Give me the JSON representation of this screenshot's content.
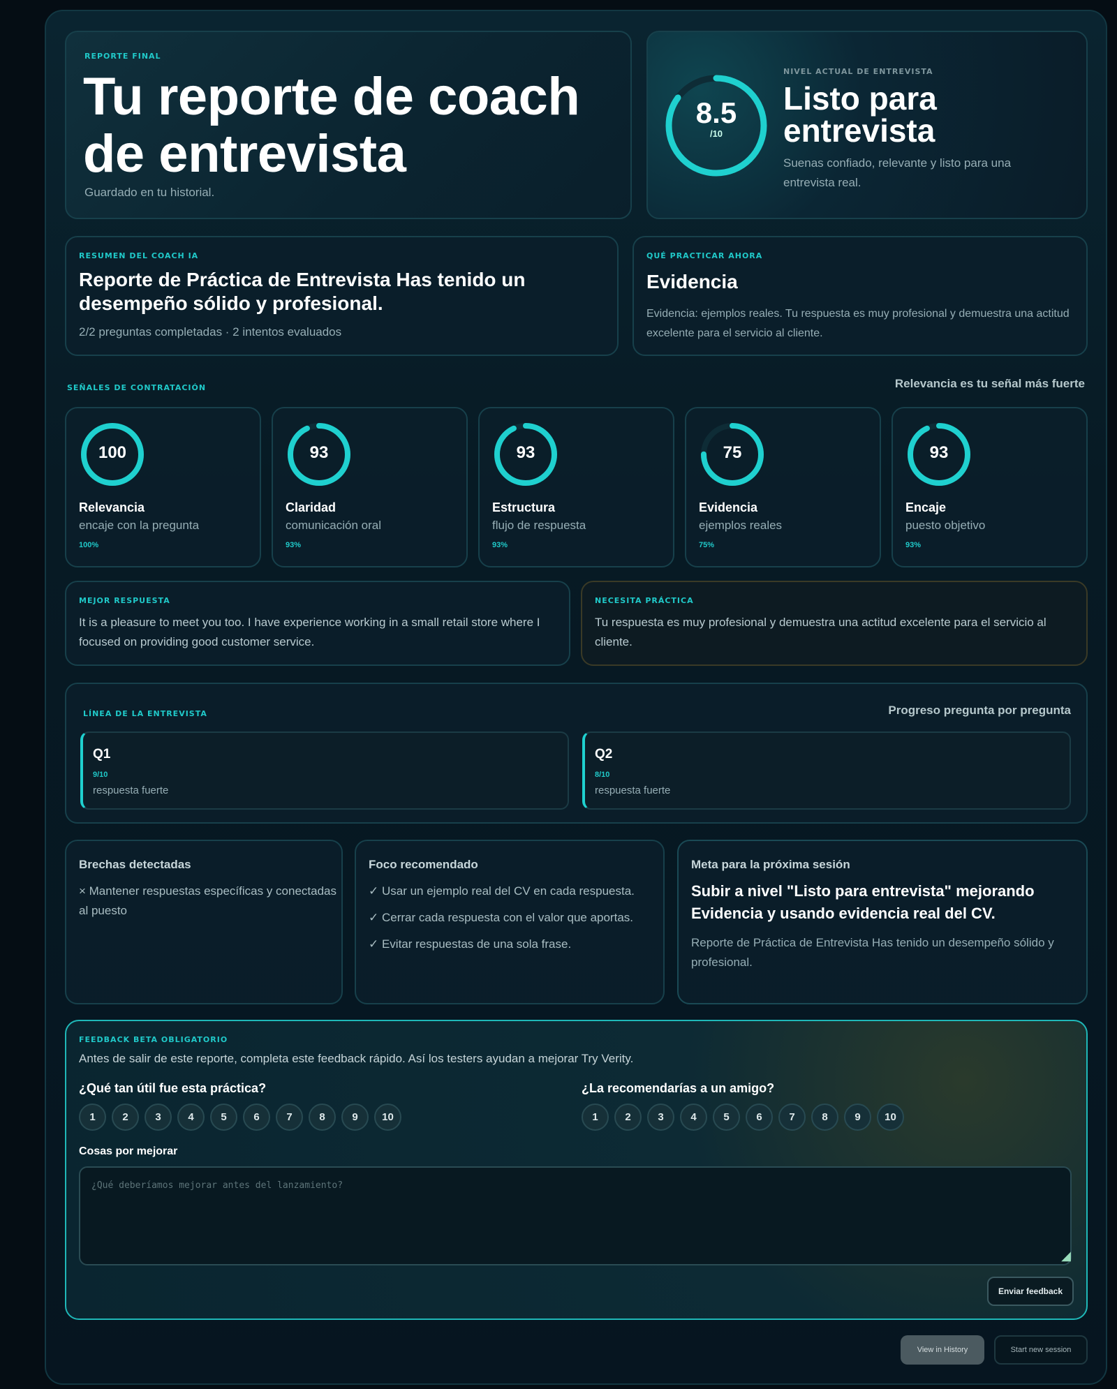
{
  "hero": {
    "eyebrow": "Reporte final",
    "title": "Tu reporte de coach de entrevista",
    "subtitle": "Guardado en tu historial."
  },
  "level": {
    "score": "8.5",
    "score_of": "/10",
    "score_fraction": 0.85,
    "eyebrow": "Nivel actual de entrevista",
    "title": "Listo para entrevista",
    "description": "Suenas confiado, relevante y listo para una entrevista real."
  },
  "summary": {
    "eyebrow": "Resumen del coach IA",
    "title": "Reporte de Práctica de Entrevista Has tenido un desempeño sólido y profesional.",
    "meta": "2/2 preguntas completadas · 2 intentos evaluados"
  },
  "practice": {
    "eyebrow": "Qué practicar ahora",
    "title": "Evidencia",
    "description": "Evidencia: ejemplos reales. Tu respuesta es muy profesional y demuestra una actitud excelente para el servicio al cliente."
  },
  "signals": {
    "label": "Señales de contratación",
    "strongest": "Relevancia es tu señal más fuerte",
    "items": [
      {
        "value": "100",
        "level": 1.0,
        "name": "Relevancia",
        "desc": "encaje con la pregunta",
        "pct": "100%"
      },
      {
        "value": "93",
        "level": 0.93,
        "name": "Claridad",
        "desc": "comunicación oral",
        "pct": "93%"
      },
      {
        "value": "93",
        "level": 0.93,
        "name": "Estructura",
        "desc": "flujo de respuesta",
        "pct": "93%"
      },
      {
        "value": "75",
        "level": 0.75,
        "name": "Evidencia",
        "desc": "ejemplos reales",
        "pct": "75%"
      },
      {
        "value": "93",
        "level": 0.93,
        "name": "Encaje",
        "desc": "puesto objetivo",
        "pct": "93%"
      }
    ]
  },
  "best": {
    "eyebrow": "Mejor respuesta",
    "text": "It is a pleasure to meet you too. I have experience working in a small retail store where I focused on providing good customer service."
  },
  "need": {
    "eyebrow": "Necesita práctica",
    "text": "Tu respuesta es muy profesional y demuestra una actitud excelente para el servicio al cliente."
  },
  "timeline": {
    "eyebrow": "Línea de la entrevista",
    "right": "Progreso pregunta por pregunta",
    "questions": [
      {
        "label": "Q1",
        "score": "9/10",
        "desc": "respuesta fuerte"
      },
      {
        "label": "Q2",
        "score": "8/10",
        "desc": "respuesta fuerte"
      }
    ]
  },
  "gaps": {
    "title": "Brechas detectadas",
    "items": [
      "× Mantener respuestas específicas y conectadas al puesto"
    ]
  },
  "focus": {
    "title": "Foco recomendado",
    "items": [
      "✓ Usar un ejemplo real del CV en cada respuesta.",
      "✓ Cerrar cada respuesta con el valor que aportas.",
      "✓ Evitar respuestas de una sola frase."
    ]
  },
  "goal": {
    "title": "Meta para la próxima sesión",
    "headline": "Subir a nivel \"Listo para entrevista\" mejorando Evidencia y usando evidencia real del CV.",
    "description": "Reporte de Práctica de Entrevista Has tenido un desempeño sólido y profesional."
  },
  "feedback": {
    "eyebrow": "Feedback beta obligatorio",
    "intro": "Antes de salir de este reporte, completa este feedback rápido. Así los testers ayudan a mejorar Try Verity.",
    "q1": "¿Qué tan útil fue esta práctica?",
    "q2": "¿La recomendarías a un amigo?",
    "scale": [
      "1",
      "2",
      "3",
      "4",
      "5",
      "6",
      "7",
      "8",
      "9",
      "10"
    ],
    "improve_label": "Cosas por mejorar",
    "placeholder": "¿Qué deberíamos mejorar antes del lanzamiento?",
    "send": "Enviar feedback"
  },
  "footer": {
    "history": "View in History",
    "new_session": "Start new session"
  },
  "colors": {
    "accent": "#1fd0cf",
    "track": "#0e2c36"
  }
}
